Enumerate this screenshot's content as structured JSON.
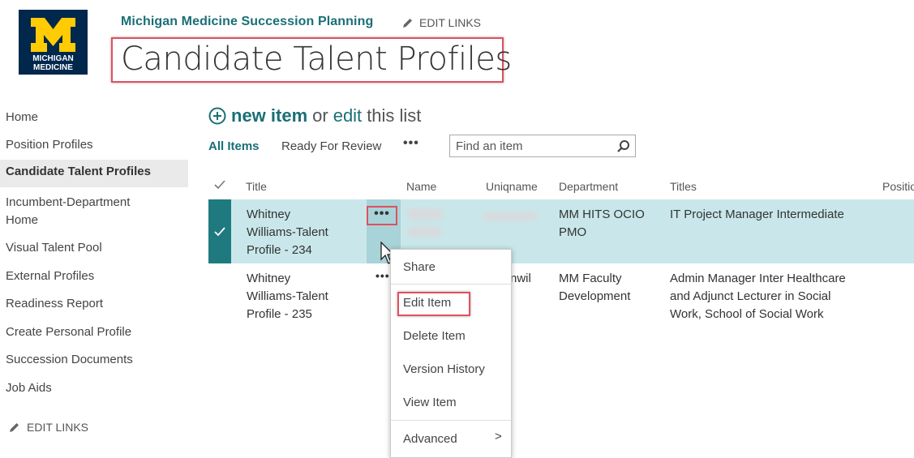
{
  "brand": {
    "logo_line1": "MICHIGAN",
    "logo_line2": "MEDICINE",
    "navy": "#00274c",
    "maize": "#ffcb05"
  },
  "header": {
    "site_title": "Michigan Medicine Succession Planning",
    "edit_links": "EDIT LINKS",
    "page_title": "Candidate Talent Profiles"
  },
  "nav": {
    "items": [
      "Home",
      "Position Profiles",
      "Candidate Talent Profiles",
      "Incumbent-Department",
      "Home",
      "Visual Talent Pool",
      "External Profiles",
      "Readiness Report",
      "Create Personal Profile",
      "Succession Documents",
      "Job Aids"
    ],
    "edit_links": "EDIT LINKS"
  },
  "commands": {
    "new_item": "new item",
    "or": "or",
    "edit": "edit",
    "this_list": "this list",
    "views": [
      "All Items",
      "Ready For Review"
    ],
    "more": "•••",
    "search_placeholder": "Find an item"
  },
  "table": {
    "columns": [
      "Title",
      "Name",
      "Uniqname",
      "Department",
      "Titles",
      "Positio"
    ],
    "rows": [
      {
        "title": [
          "Whitney",
          "Williams-Talent",
          "Profile - 234"
        ],
        "department": [
          "MM HITS OCIO",
          "PMO"
        ],
        "titles": [
          "IT Project Manager Intermediate"
        ]
      },
      {
        "title": [
          "Whitney",
          "Williams-Talent",
          "Profile - 235"
        ],
        "uniqname_partial": "nwil",
        "department": [
          "MM Faculty",
          "Development"
        ],
        "titles": [
          "Admin Manager Inter Healthcare",
          "and Adjunct Lecturer in Social",
          "Work, School of Social Work"
        ]
      }
    ]
  },
  "context_menu": {
    "items": [
      "Share",
      "Edit Item",
      "Delete Item",
      "Version History",
      "View Item",
      "Advanced"
    ],
    "submenu_arrow": ">"
  },
  "colors": {
    "accent": "#1a6f76",
    "selected_row": "#c9e7ea",
    "highlight_box": "#e05060"
  }
}
